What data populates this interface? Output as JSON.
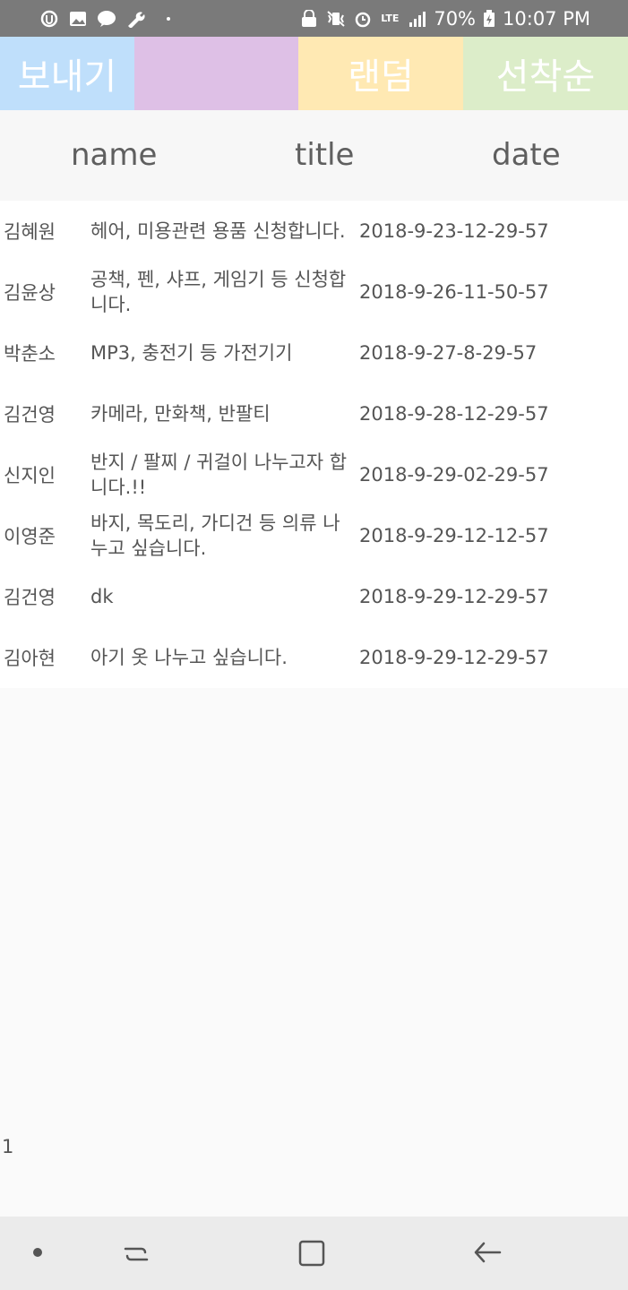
{
  "status_bar": {
    "battery": "70%",
    "time": "10:07 PM",
    "network": "LTE",
    "icons": [
      "u-plus-icon",
      "gallery-icon",
      "kakaotalk-icon",
      "wrench-icon",
      "dot-icon",
      "sync-lock-icon",
      "vibrate-mute-icon",
      "alarm-icon",
      "lte-icon",
      "signal-icon",
      "battery-charging-icon"
    ]
  },
  "toolbar": {
    "send_label": "보내기",
    "middle_label": "",
    "random_label": "랜덤",
    "first_come_label": "선착순",
    "colors": {
      "send": "#bfdffb",
      "middle": "#dec0e6",
      "random": "#ffe9b3",
      "first_come": "#dcedc9"
    }
  },
  "columns": {
    "name": "name",
    "title": "title",
    "date": "date"
  },
  "rows": [
    {
      "name": "김혜원",
      "title": "헤어, 미용관련 용품 신청합니다.",
      "date": "2018-9-23-12-29-57"
    },
    {
      "name": "김윤상",
      "title": "공책, 펜, 샤프, 게임기 등 신청합니다.",
      "date": "2018-9-26-11-50-57"
    },
    {
      "name": "박춘소",
      "title": "MP3, 충전기 등 가전기기",
      "date": "2018-9-27-8-29-57"
    },
    {
      "name": "김건영",
      "title": "카메라, 만화책, 반팔티",
      "date": "2018-9-28-12-29-57"
    },
    {
      "name": "신지인",
      "title": "반지 / 팔찌 / 귀걸이 나누고자 합니다.!!",
      "date": "2018-9-29-02-29-57"
    },
    {
      "name": "이영준",
      "title": "바지, 목도리, 가디건 등 의류 나누고 싶습니다.",
      "date": "2018-9-29-12-12-57"
    },
    {
      "name": "김건영",
      "title": "dk",
      "date": "2018-9-29-12-29-57"
    },
    {
      "name": "김아현",
      "title": "아기 옷 나누고 싶습니다.",
      "date": "2018-9-29-12-29-57"
    }
  ],
  "page_number": "1",
  "nav_bar": {
    "icons": [
      "dot-icon",
      "recent-apps-icon",
      "home-icon",
      "back-icon"
    ]
  }
}
